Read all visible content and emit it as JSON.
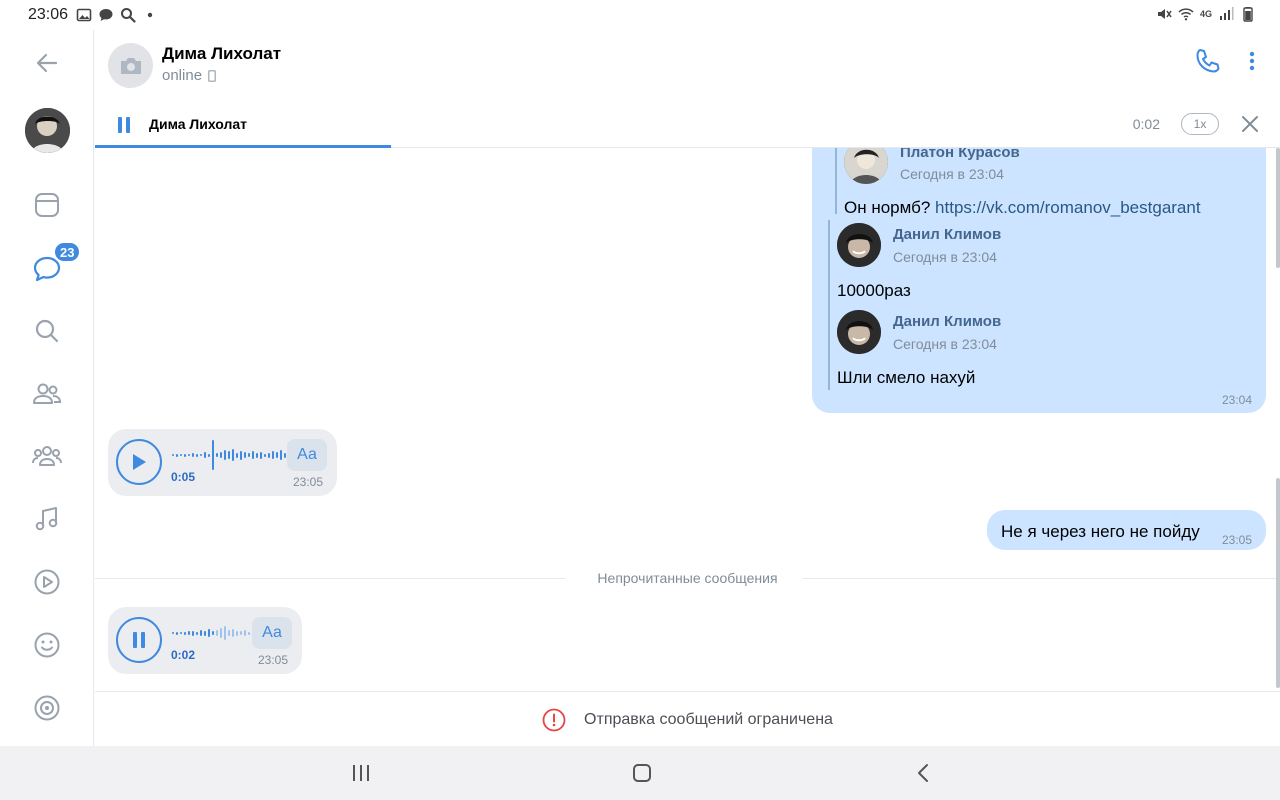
{
  "status_bar": {
    "time": "23:06",
    "network": "4G"
  },
  "sidebar": {
    "badge_count": "23",
    "items": [
      {
        "name": "back",
        "icon": "arrow-left-icon"
      },
      {
        "name": "profile",
        "icon": "avatar"
      },
      {
        "name": "news",
        "icon": "newsfeed-icon"
      },
      {
        "name": "messages",
        "icon": "chat-bubble-icon"
      },
      {
        "name": "search",
        "icon": "search-icon"
      },
      {
        "name": "friends",
        "icon": "friends-icon"
      },
      {
        "name": "communities",
        "icon": "communities-icon"
      },
      {
        "name": "music",
        "icon": "music-note-icon"
      },
      {
        "name": "video",
        "icon": "play-circle-icon"
      },
      {
        "name": "stickers",
        "icon": "smile-icon"
      },
      {
        "name": "services",
        "icon": "target-icon"
      }
    ]
  },
  "header": {
    "name": "Дима Лихолат",
    "status": "online"
  },
  "player": {
    "title": "Дима Лихолат",
    "time": "0:02",
    "speed": "1x",
    "progress": 0.25
  },
  "chat": {
    "forwarded": [
      {
        "author": "Платон Курасов",
        "time": "Сегодня в 23:04",
        "text": "Он нормб? ",
        "link": "https://vk.com/romanov_bestgarant"
      },
      {
        "author": "Данил Климов",
        "time": "Сегодня в 23:04",
        "text": "10000раз"
      },
      {
        "author": "Данил Климов",
        "time": "Сегодня в 23:04",
        "text": "Шли смело нахуй"
      }
    ],
    "forward_msg_time": "23:04",
    "voice1": {
      "duration": "0:05",
      "time": "23:05",
      "aa": "Аа"
    },
    "out_msg": {
      "text": "Не я через него не пойду",
      "time": "23:05"
    },
    "unread_label": "Непрочитанные сообщения",
    "voice2": {
      "duration": "0:02",
      "time": "23:05",
      "aa": "Аа",
      "played": 0.45
    }
  },
  "restricted": {
    "text": "Отправка сообщений ограничена"
  },
  "colors": {
    "accent": "#3f8ae0",
    "bubble_out": "#cce4ff",
    "bubble_in": "#ebedf0",
    "alert": "#e64646"
  }
}
